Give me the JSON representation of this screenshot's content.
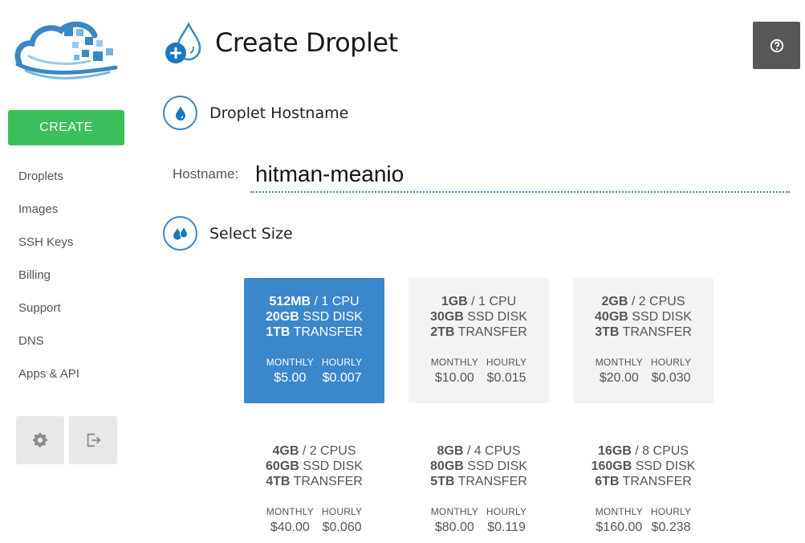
{
  "sidebar": {
    "create_label": "CREATE",
    "nav": [
      "Droplets",
      "Images",
      "SSH Keys",
      "Billing",
      "Support",
      "DNS",
      "Apps & API"
    ]
  },
  "header": {
    "title": "Create Droplet"
  },
  "hostname_section": {
    "title": "Droplet Hostname",
    "label": "Hostname:",
    "value": "hitman-meanio"
  },
  "size_section": {
    "title": "Select Size",
    "monthly_label": "MONTHLY",
    "hourly_label": "HOURLY",
    "sizes": [
      {
        "ram": "512MB",
        "cpu": " / 1 CPU",
        "disk": "20GB",
        "disk_suffix": " SSD DISK",
        "transfer": "1TB",
        "transfer_suffix": " TRANSFER",
        "monthly": "$5.00",
        "hourly": "$0.007",
        "selected": true
      },
      {
        "ram": "1GB",
        "cpu": " / 1 CPU",
        "disk": "30GB",
        "disk_suffix": " SSD DISK",
        "transfer": "2TB",
        "transfer_suffix": " TRANSFER",
        "monthly": "$10.00",
        "hourly": "$0.015",
        "selected": false
      },
      {
        "ram": "2GB",
        "cpu": " / 2 CPUS",
        "disk": "40GB",
        "disk_suffix": " SSD DISK",
        "transfer": "3TB",
        "transfer_suffix": " TRANSFER",
        "monthly": "$20.00",
        "hourly": "$0.030",
        "selected": false
      },
      {
        "ram": "4GB",
        "cpu": " / 2 CPUS",
        "disk": "60GB",
        "disk_suffix": " SSD DISK",
        "transfer": "4TB",
        "transfer_suffix": " TRANSFER",
        "monthly": "$40.00",
        "hourly": "$0.060",
        "selected": false
      },
      {
        "ram": "8GB",
        "cpu": " / 4 CPUS",
        "disk": "80GB",
        "disk_suffix": " SSD DISK",
        "transfer": "5TB",
        "transfer_suffix": " TRANSFER",
        "monthly": "$80.00",
        "hourly": "$0.119",
        "selected": false
      },
      {
        "ram": "16GB",
        "cpu": " / 8 CPUS",
        "disk": "160GB",
        "disk_suffix": " SSD DISK",
        "transfer": "6TB",
        "transfer_suffix": " TRANSFER",
        "monthly": "$160.00",
        "hourly": "$0.238",
        "selected": false
      }
    ]
  },
  "colors": {
    "accent": "#3a87cb",
    "create": "#3bbf5b",
    "help_bg": "#575757"
  },
  "icons": {
    "settings": "gear-icon",
    "logout": "logout-icon",
    "help": "help-icon"
  }
}
